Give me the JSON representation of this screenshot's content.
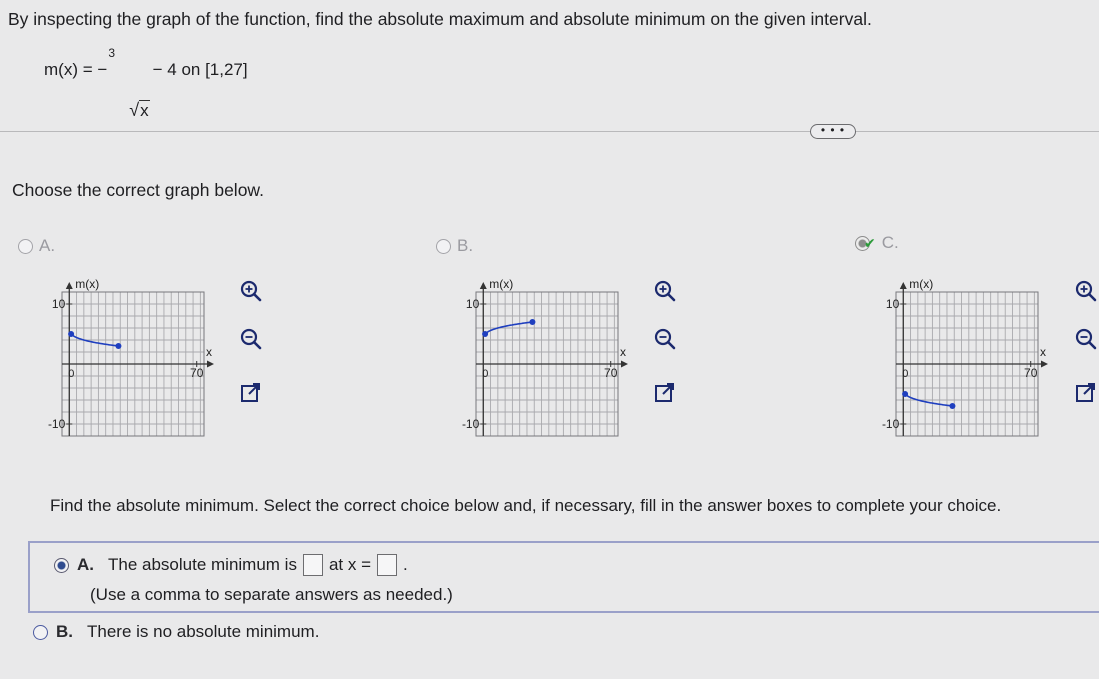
{
  "question": {
    "instruction": "By inspecting the graph of the function, find the absolute maximum and absolute minimum on the given interval.",
    "function_lhs": "m(x) =",
    "function_neg": "−",
    "radical_index": "3",
    "radical_arg": "x",
    "function_rest": "− 4 on [1,27]"
  },
  "more_button": "• • •",
  "prompt_graph": "Choose the correct graph below.",
  "graph_options": [
    {
      "letter": "A.",
      "selected": false,
      "y_label": "m(x)",
      "x_label": "x",
      "y_max_label": "10",
      "y_min_label": "-10",
      "x_max_label": "70",
      "origin_label": "0",
      "curve": {
        "start": [
          1,
          5
        ],
        "end": [
          27,
          3
        ]
      }
    },
    {
      "letter": "B.",
      "selected": false,
      "y_label": "m(x)",
      "x_label": "x",
      "y_max_label": "10",
      "y_min_label": "-10",
      "x_max_label": "70",
      "origin_label": "0",
      "curve": {
        "start": [
          1,
          5
        ],
        "end": [
          27,
          7
        ]
      }
    },
    {
      "letter": "C.",
      "selected": true,
      "y_label": "m(x)",
      "x_label": "x",
      "y_max_label": "10",
      "y_min_label": "-10",
      "x_max_label": "70",
      "origin_label": "0",
      "curve": {
        "start": [
          1,
          -5
        ],
        "end": [
          27,
          -7
        ]
      }
    }
  ],
  "axes": {
    "x_range": [
      -4,
      74
    ],
    "y_range": [
      -12,
      12
    ]
  },
  "colors": {
    "curve": "#1f3fbf",
    "grid": "#a9a9ad",
    "check": "#2c9a3a",
    "accent": "#2f4b8f"
  },
  "tools": [
    "zoom-in-icon",
    "zoom-out-icon",
    "new-window-icon"
  ],
  "prompt_min": "Find the absolute minimum. Select the correct choice below and, if necessary, fill in the answer boxes to complete your choice.",
  "answer_a": {
    "letter": "A.",
    "text1": "The absolute minimum is",
    "text2": "at x =",
    "end": ".",
    "note": "(Use a comma to separate answers as needed.)"
  },
  "answer_b": {
    "letter": "B.",
    "text": "There is no absolute minimum."
  }
}
